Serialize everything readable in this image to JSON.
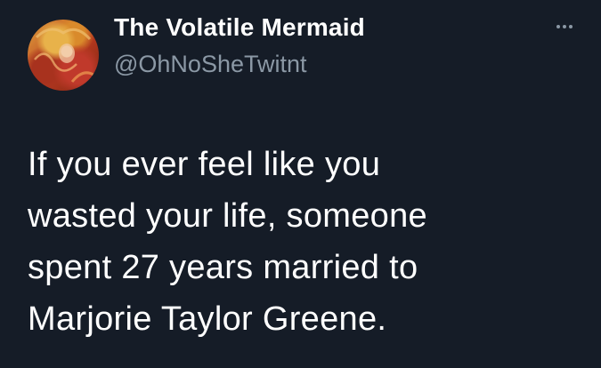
{
  "tweet": {
    "author": {
      "display_name": "The Volatile Mermaid",
      "handle": "@OhNoSheTwitnt",
      "avatar_icon": "profile-photo"
    },
    "more_icon": "more-options-icon",
    "text": "If you ever feel like you\nwasted your life, someone\nspent 27 years married to\nMarjorie Taylor Greene."
  },
  "colors": {
    "background": "#151c27",
    "name": "#ffffff",
    "handle": "#8b98a5",
    "body_text": "#ffffff"
  }
}
